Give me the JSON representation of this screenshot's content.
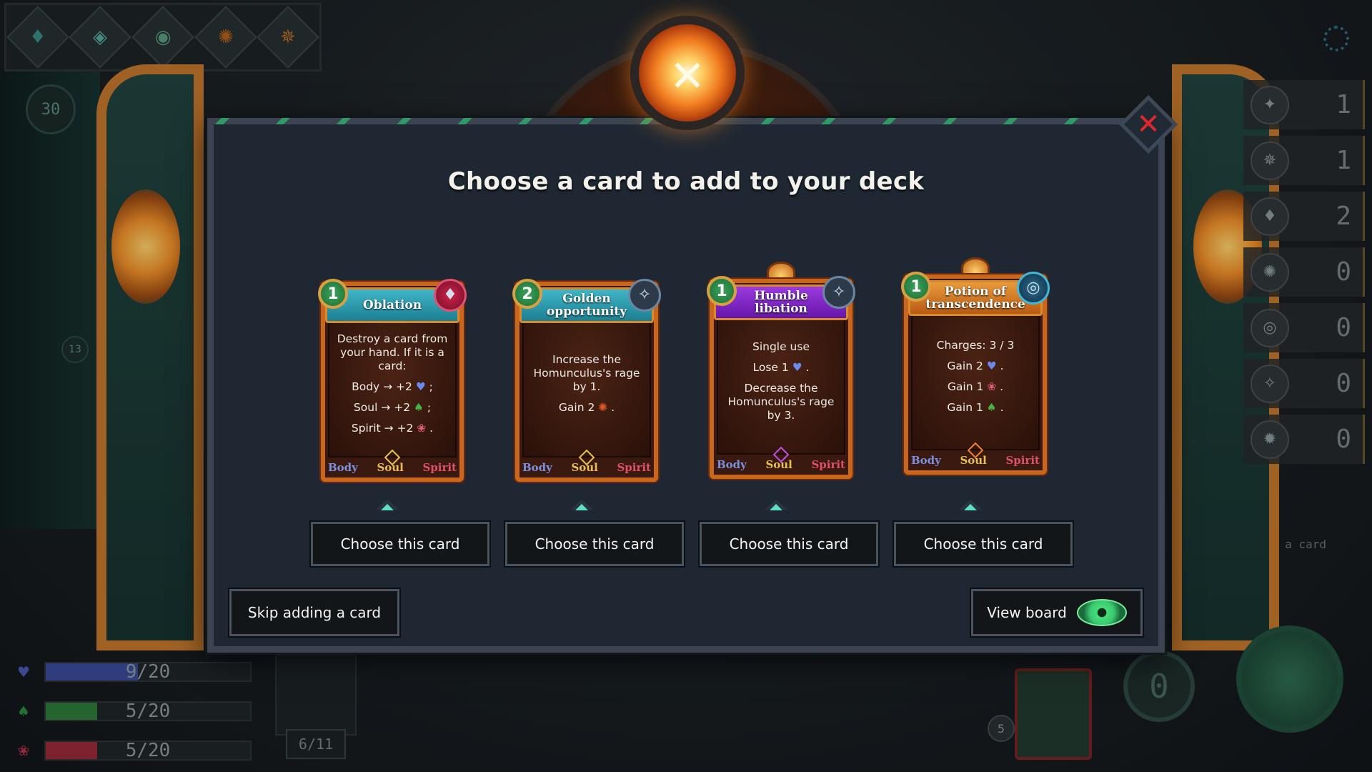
{
  "modal": {
    "title": "Choose a card to add to your deck",
    "close_icon": "✕",
    "skip_label": "Skip adding a card",
    "view_board_label": "View board"
  },
  "cards": [
    {
      "name": "Oblation",
      "cost": "1",
      "type_icon": "feather-drop-icon",
      "banner": "teal",
      "lines": [
        "Destroy a card from your hand. If it is a card:",
        "Body → +2",
        "Soul → +2",
        "Spirit → +2"
      ],
      "line_suffixes": [
        "",
        " ;",
        " ;",
        " ."
      ],
      "footer": [
        "Body",
        "Soul",
        "Spirit"
      ],
      "choose_label": "Choose this card"
    },
    {
      "name": "Golden opportunity",
      "cost": "2",
      "type_icon": "rune-icon",
      "banner": "teal",
      "lines": [
        "Increase the Homunculus's rage by 1.",
        "Gain 2"
      ],
      "line_suffixes": [
        "",
        " ."
      ],
      "footer": [
        "Body",
        "Soul",
        "Spirit"
      ],
      "choose_label": "Choose this card"
    },
    {
      "name": "Humble libation",
      "cost": "1",
      "type_icon": "rune-icon",
      "banner": "purple",
      "lines": [
        "Single use",
        "Lose 1",
        "Decrease the Homunculus's rage by 3."
      ],
      "line_suffixes": [
        "",
        " .",
        ""
      ],
      "footer": [
        "Body",
        "Soul",
        "Spirit"
      ],
      "choose_label": "Choose this card"
    },
    {
      "name": "Potion of transcendence",
      "cost": "1",
      "type_icon": "swirl-icon",
      "banner": "orange",
      "lines": [
        "Charges: 3 / 3",
        "Gain 2",
        "Gain 1",
        "Gain 1"
      ],
      "line_suffixes": [
        "",
        " .",
        " .",
        " ."
      ],
      "footer": [
        "Body",
        "Soul",
        "Spirit"
      ],
      "choose_label": "Choose this card"
    }
  ],
  "hud": {
    "turn": "30",
    "rail_badge": "13",
    "resources": [
      "1",
      "1",
      "2",
      "0",
      "0",
      "0",
      "0"
    ],
    "side_caption": "a card",
    "stats": [
      {
        "text": "9/20",
        "fill": 0.45,
        "color": "#3a4a9a"
      },
      {
        "text": "5/20",
        "fill": 0.25,
        "color": "#2f7a3a"
      },
      {
        "text": "5/20",
        "fill": 0.25,
        "color": "#9a2a3a"
      }
    ],
    "deck_count": "6/11",
    "energy": "0",
    "mini_count": "5"
  },
  "colors": {
    "accent_teal": "#5ee0c8",
    "close_red": "#e2262e",
    "eye_green": "#46e07a"
  }
}
